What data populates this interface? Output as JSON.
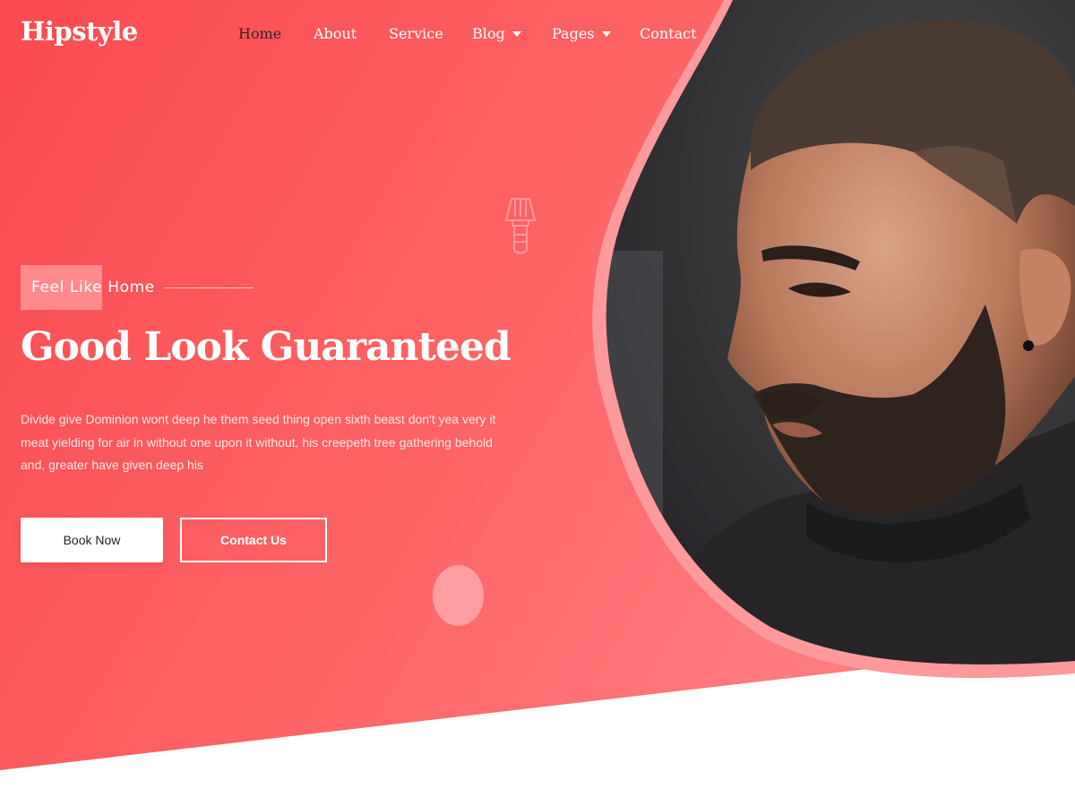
{
  "brand": {
    "name": "Hipstyle"
  },
  "nav": {
    "items": [
      {
        "label": "Home",
        "active": true,
        "dropdown": false
      },
      {
        "label": "About",
        "active": false,
        "dropdown": false
      },
      {
        "label": "Service",
        "active": false,
        "dropdown": false
      },
      {
        "label": "Blog",
        "active": false,
        "dropdown": true
      },
      {
        "label": "Pages",
        "active": false,
        "dropdown": true
      },
      {
        "label": "Contact",
        "active": false,
        "dropdown": false
      }
    ]
  },
  "hero": {
    "tagline": "Feel Like Home",
    "title": "Good Look Guaranteed",
    "description": "Divide give Dominion wont deep he them seed thing open sixth beast don't yea very it meat yielding for air in without one upon it without, his creepeth tree gathering behold and, greater have given deep his",
    "book_button": "Book Now",
    "contact_button": "Contact Us",
    "image": "barber-client-portrait"
  },
  "icons": {
    "decoration": "shaving-brush-icon",
    "dropdown": "chevron-down-icon"
  },
  "colors": {
    "gradient_start": "#fa4a4f",
    "gradient_end": "#ff8688",
    "accent_light": "#ff8b8d",
    "active_nav": "#3a2424",
    "photo_border": "#ff9a9c"
  }
}
